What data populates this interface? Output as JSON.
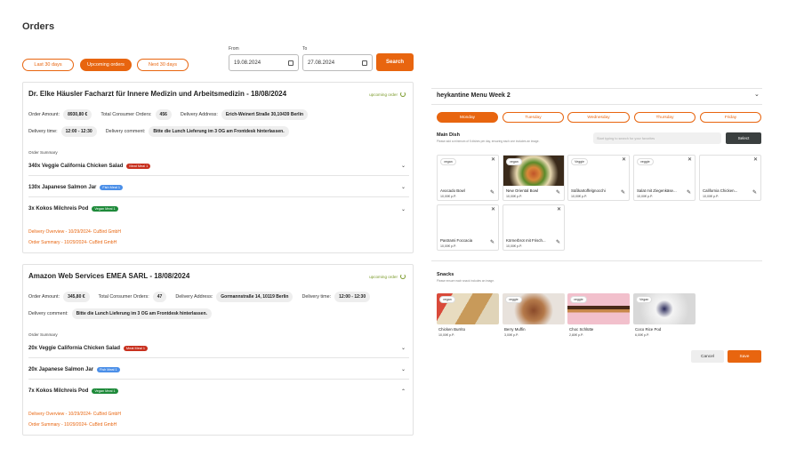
{
  "page": {
    "title": "Orders"
  },
  "filters": {
    "tabs": [
      "Last 30 days",
      "Upcoming orders",
      "Next 30 days"
    ],
    "from_label": "From",
    "to_label": "To",
    "from_value": "19.08.2024",
    "to_value": "27.08.2024",
    "search_label": "Search"
  },
  "orders": [
    {
      "title": "Dr. Elke Häusler Facharzt für Innere Medizin und Arbeitsmedizin - 18/08/2024",
      "status": "upcoming order",
      "amount_label": "Order Amount:",
      "amount": "8930,80 €",
      "consumers_label": "Total Consumer Orders:",
      "consumers": "456",
      "address_label": "Delivery Address:",
      "address": "Erich-Weinert Straße 30,10439 Berlin",
      "time_label": "Delivery time:",
      "time": "12:00 - 12:30",
      "comment_label": "Delivery comment:",
      "comment": "Bitte die Lunch Lieferung im 3 OG am Frontdesk hinterlassen.",
      "summary_label": "Order Summary",
      "items": [
        {
          "name": "340x Veggie California Chicken Salad",
          "badge": "Meat Meal 1"
        },
        {
          "name": "130x Japanese Salmon Jar",
          "badge": "Fish Meal 1"
        },
        {
          "name": "3x Kokos Milchreis Pod",
          "badge": "Vegan Meal 1"
        }
      ],
      "links": [
        "Delivery Overview - 10/29/2024- CuBird GmbH",
        "Order Summary - 10/29/2024- CuBird GmbH"
      ]
    },
    {
      "title": "Amazon Web Services EMEA SARL - 18/08/2024",
      "status": "upcoming order",
      "amount_label": "Order Amount:",
      "amount": "345,80 €",
      "consumers_label": "Total Consumer Orders:",
      "consumers": "47",
      "address_label": "Delivery Address:",
      "address": "Gormannstraße 14, 10119 Berlin",
      "time_label": "Delivery time:",
      "time": "12:00 - 12:30",
      "comment_label": "Delivery comment:",
      "comment": "Bitte die Lunch Lieferung im 3 OG am Frontdesk hinterlassen.",
      "summary_label": "Order Summary",
      "items": [
        {
          "name": "20x Veggie California Chicken Salad",
          "badge": "Meat Meal 1"
        },
        {
          "name": "20x Japanese Salmon Jar",
          "badge": "Fish Meal 1"
        },
        {
          "name": "7x Kokos Milchreis Pod",
          "badge": "Vegan Meal 1"
        }
      ],
      "links": [
        "Delivery Overview - 10/29/2024- CuBird GmbH",
        "Order Summary - 10/29/2024- CuBird GmbH"
      ]
    }
  ],
  "menu": {
    "title": "heykantine Menu Week 2",
    "days": [
      "Monday",
      "Tuesday",
      "Wednesday",
      "Thursday",
      "Friday"
    ],
    "main_title": "Main Dish",
    "main_sub": "Please add a minimum of 5 dishes per day, ensuring each one includes an image.",
    "search_placeholder": "Start typing to search for your favorites",
    "select_label": "Select",
    "dishes": [
      {
        "name": "Avocado Bowl",
        "price": "10,00€ p.P.",
        "badge": "vegan"
      },
      {
        "name": "New Oriental Bowl",
        "price": "10,00€ p.P.",
        "badge": "vegan"
      },
      {
        "name": "Süßkartoffelgnocchi",
        "price": "10,00€ p.P.",
        "badge": "Veggie"
      },
      {
        "name": "Salat mit Ziegenkäse...",
        "price": "10,00€ p.P.",
        "badge": "veggie"
      },
      {
        "name": "California Chicken...",
        "price": "10,00€ p.P.",
        "badge": ""
      },
      {
        "name": "Pastrami Foccacia",
        "price": "10,00€ p.P.",
        "badge": ""
      },
      {
        "name": "Körnerbrot mit Frisch...",
        "price": "10,00€ p.P.",
        "badge": ""
      }
    ],
    "snacks_title": "Snacks",
    "snacks_sub": "Please ensure each snack includes an image.",
    "snacks": [
      {
        "name": "Chicken Burrito",
        "price": "10,00€ p.P.",
        "badge": "vegan"
      },
      {
        "name": "Berry Muffin",
        "price": "3,00€ p.P.",
        "badge": "veggie"
      },
      {
        "name": "Choc Schlütte",
        "price": "2,80€ p.P.",
        "badge": "veggie"
      },
      {
        "name": "Coco Rice Pod",
        "price": "6,00€ p.P.",
        "badge": "Vegan"
      }
    ],
    "cancel_label": "Cancel",
    "save_label": "Save"
  }
}
